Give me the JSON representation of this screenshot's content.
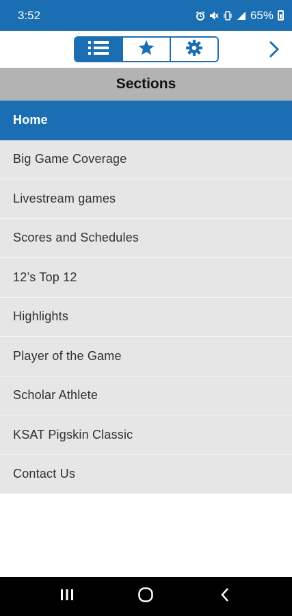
{
  "status_bar": {
    "time": "3:52",
    "battery_percent": "65%",
    "icons": [
      "alarm-icon",
      "mute-icon",
      "vibrate-icon",
      "signal-icon",
      "battery-icon"
    ]
  },
  "toolbar": {
    "tabs": [
      {
        "icon": "list-icon",
        "active": true
      },
      {
        "icon": "star-icon",
        "active": false
      },
      {
        "icon": "gear-icon",
        "active": false
      }
    ],
    "next_icon": "chevron-right-icon"
  },
  "sections": {
    "title": "Sections",
    "items": [
      {
        "label": "Home",
        "selected": true
      },
      {
        "label": "Big Game Coverage"
      },
      {
        "label": "Livestream games"
      },
      {
        "label": "Scores and Schedules"
      },
      {
        "label": "12’s Top 12"
      },
      {
        "label": "Highlights"
      },
      {
        "label": "Player of the Game"
      },
      {
        "label": "Scholar Athlete"
      },
      {
        "label": "KSAT Pigskin Classic"
      },
      {
        "label": "Contact Us"
      }
    ]
  },
  "nav_bar": {
    "buttons": [
      "recents-icon",
      "home-icon",
      "back-icon"
    ]
  },
  "colors": {
    "brand": "#1a6eb1",
    "header_gray": "#b3b3b3",
    "item_gray": "#e6e6e6"
  }
}
